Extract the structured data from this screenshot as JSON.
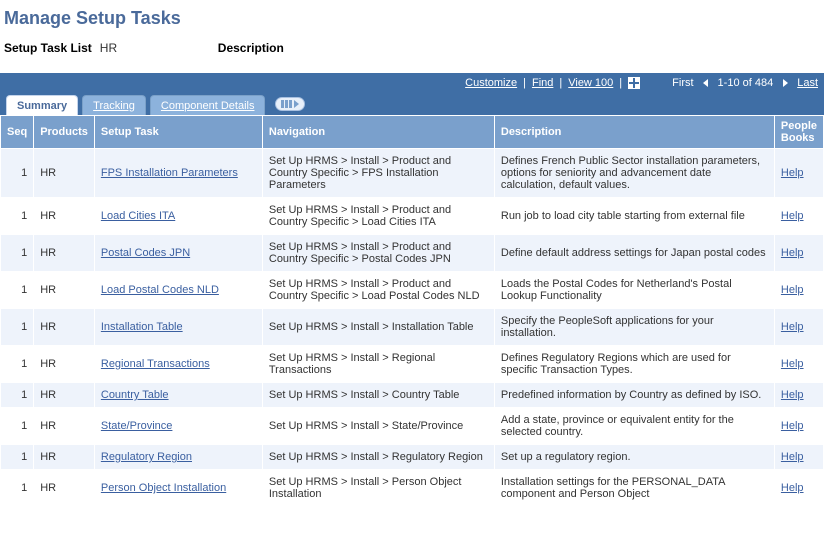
{
  "page_title": "Manage Setup Tasks",
  "header": {
    "list_label": "Setup Task List",
    "list_value": "HR",
    "desc_label": "Description",
    "desc_value": ""
  },
  "gridbar": {
    "customize": "Customize",
    "find": "Find",
    "view_all": "View 100",
    "first": "First",
    "range": "1-10 of 484",
    "last": "Last"
  },
  "tabs": {
    "summary": "Summary",
    "tracking": "Tracking",
    "details": "Component Details"
  },
  "columns": {
    "seq": "Seq",
    "products": "Products",
    "task": "Setup Task",
    "nav": "Navigation",
    "desc": "Description",
    "pb": "People Books"
  },
  "help_label": "Help",
  "rows": [
    {
      "seq": "1",
      "products": "HR",
      "task": "FPS Installation Parameters",
      "nav": "Set Up HRMS > Install > Product and Country Specific > FPS Installation Parameters",
      "desc": "Defines French Public Sector installation parameters, options for seniority and advancement date calculation, default values."
    },
    {
      "seq": "1",
      "products": "HR",
      "task": "Load Cities ITA",
      "nav": "Set Up HRMS > Install > Product and Country Specific > Load Cities ITA",
      "desc": "Run job to load city table starting from external file"
    },
    {
      "seq": "1",
      "products": "HR",
      "task": "Postal Codes JPN",
      "nav": "Set Up HRMS > Install > Product and Country Specific > Postal Codes JPN",
      "desc": "Define default address settings for Japan postal codes"
    },
    {
      "seq": "1",
      "products": "HR",
      "task": "Load Postal Codes NLD",
      "nav": "Set Up HRMS > Install > Product and Country Specific > Load Postal Codes NLD",
      "desc": "Loads the Postal Codes for Netherland's Postal Lookup Functionality"
    },
    {
      "seq": "1",
      "products": "HR",
      "task": "Installation Table",
      "nav": "Set Up HRMS > Install > Installation Table",
      "desc": "Specify the PeopleSoft applications for your installation."
    },
    {
      "seq": "1",
      "products": "HR",
      "task": "Regional Transactions",
      "nav": "Set Up HRMS > Install > Regional Transactions",
      "desc": "Defines Regulatory Regions which are used for specific Transaction Types."
    },
    {
      "seq": "1",
      "products": "HR",
      "task": "Country Table",
      "nav": "Set Up HRMS > Install > Country Table",
      "desc": "Predefined information by Country as defined by ISO."
    },
    {
      "seq": "1",
      "products": "HR",
      "task": "State/Province",
      "nav": "Set Up HRMS > Install > State/Province",
      "desc": "Add a state, province or equivalent entity for the selected country."
    },
    {
      "seq": "1",
      "products": "HR",
      "task": "Regulatory Region",
      "nav": "Set Up HRMS > Install > Regulatory Region",
      "desc": "Set up a regulatory region."
    },
    {
      "seq": "1",
      "products": "HR",
      "task": "Person Object Installation",
      "nav": "Set Up HRMS > Install > Person Object Installation",
      "desc": "Installation settings for the PERSONAL_DATA component and Person Object"
    }
  ]
}
